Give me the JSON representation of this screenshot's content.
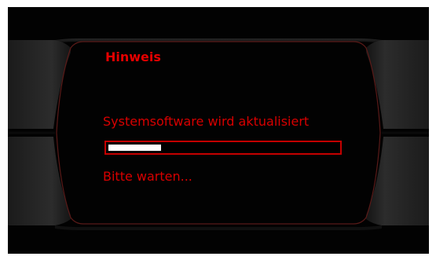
{
  "dialog": {
    "title": "Hinweis",
    "message": "Systemsoftware wird aktualisiert",
    "status": "Bitte warten..."
  },
  "progress": {
    "fraction": 0.23
  },
  "colors": {
    "text_red": "#d80000",
    "title_red": "#e50000",
    "frame_red": "#5a1a18",
    "progress_fill": "#ffffff",
    "background": "#020202"
  }
}
